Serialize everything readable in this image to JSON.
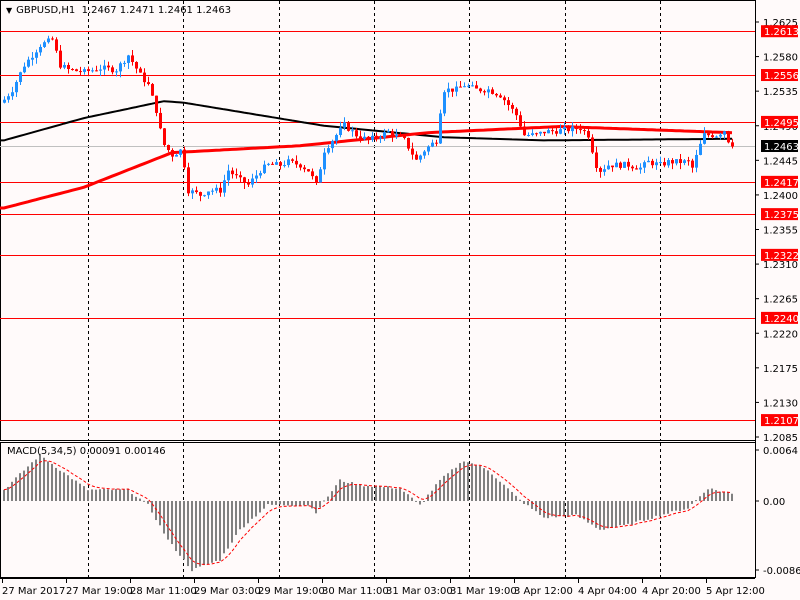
{
  "header": {
    "symbol": "GBPUSD,H1",
    "ohlc": "1.2467 1.2471 1.2461 1.2463",
    "menu_icon": "triangle-down-icon"
  },
  "macd_label": {
    "name": "MACD(5,34,5)",
    "values": "0.00091 0.00146"
  },
  "colors": {
    "bull": "#1e90ff",
    "bear": "#ff0000",
    "level": "#ff0000",
    "ma_slow": "#ff0000",
    "ma_fast": "#000000",
    "macd_hist": "#808080",
    "current": "#000000",
    "background": "#fffafa"
  },
  "chart_data": {
    "type": "candlestick",
    "title": "GBPUSD,H1",
    "ylim": [
      1.2085,
      1.2625
    ],
    "y_ticks": [
      "1.2625",
      "1.2580",
      "1.2535",
      "1.2490",
      "1.2445",
      "1.2400",
      "1.2355",
      "1.2310",
      "1.2265",
      "1.2220",
      "1.2175",
      "1.2130",
      "1.2085"
    ],
    "x_ticks": [
      "27 Mar 2017",
      "27 Mar 19:00",
      "28 Mar 11:00",
      "29 Mar 03:00",
      "29 Mar 19:00",
      "30 Mar 11:00",
      "31 Mar 03:00",
      "31 Mar 19:00",
      "3 Apr 12:00",
      "4 Apr 04:00",
      "4 Apr 20:00",
      "5 Apr 12:00"
    ],
    "levels": [
      "1.2613",
      "1.2556",
      "1.2495",
      "1.2417",
      "1.2375",
      "1.2322",
      "1.2240",
      "1.2107"
    ],
    "current_price": "1.2463",
    "close_keypoints": [
      [
        0,
        1.2524
      ],
      [
        2,
        1.2537
      ],
      [
        5,
        1.2569
      ],
      [
        9,
        1.2595
      ],
      [
        12,
        1.2602
      ],
      [
        14,
        1.2569
      ],
      [
        16,
        1.2563
      ],
      [
        20,
        1.256
      ],
      [
        24,
        1.2565
      ],
      [
        28,
        1.2563
      ],
      [
        31,
        1.2582
      ],
      [
        34,
        1.2556
      ],
      [
        36,
        1.2543
      ],
      [
        38,
        1.251
      ],
      [
        39,
        1.2484
      ],
      [
        40,
        1.2465
      ],
      [
        42,
        1.2452
      ],
      [
        44,
        1.2458
      ],
      [
        45,
        1.2439
      ],
      [
        46,
        1.2406
      ],
      [
        49,
        1.24
      ],
      [
        51,
        1.2406
      ],
      [
        54,
        1.2406
      ],
      [
        56,
        1.2432
      ],
      [
        59,
        1.2419
      ],
      [
        61,
        1.2413
      ],
      [
        64,
        1.2432
      ],
      [
        66,
        1.2439
      ],
      [
        69,
        1.2439
      ],
      [
        71,
        1.2443
      ],
      [
        74,
        1.2439
      ],
      [
        76,
        1.2432
      ],
      [
        78,
        1.2413
      ],
      [
        80,
        1.2458
      ],
      [
        83,
        1.2478
      ],
      [
        85,
        1.2491
      ],
      [
        88,
        1.2478
      ],
      [
        91,
        1.2471
      ],
      [
        96,
        1.2482
      ],
      [
        100,
        1.2471
      ],
      [
        103,
        1.2445
      ],
      [
        105,
        1.2458
      ],
      [
        108,
        1.2471
      ],
      [
        109,
        1.251
      ],
      [
        110,
        1.2537
      ],
      [
        113,
        1.2537
      ],
      [
        115,
        1.2543
      ],
      [
        118,
        1.2537
      ],
      [
        121,
        1.2537
      ],
      [
        124,
        1.253
      ],
      [
        125,
        1.2524
      ],
      [
        128,
        1.2504
      ],
      [
        130,
        1.2478
      ],
      [
        133,
        1.2478
      ],
      [
        135,
        1.2482
      ],
      [
        139,
        1.2484
      ],
      [
        144,
        1.2487
      ],
      [
        146,
        1.2478
      ],
      [
        148,
        1.2439
      ],
      [
        149,
        1.2432
      ],
      [
        151,
        1.2439
      ],
      [
        154,
        1.2439
      ],
      [
        156,
        1.2439
      ],
      [
        159,
        1.2435
      ],
      [
        161,
        1.2443
      ],
      [
        164,
        1.2439
      ],
      [
        166,
        1.2443
      ],
      [
        171,
        1.2443
      ],
      [
        172,
        1.2435
      ],
      [
        174,
        1.2465
      ],
      [
        175,
        1.2478
      ],
      [
        178,
        1.2478
      ],
      [
        180,
        1.2484
      ],
      [
        181,
        1.2471
      ],
      [
        182,
        1.2463
      ]
    ],
    "ma_fast_keypoints": [
      [
        0,
        1.2471
      ],
      [
        20,
        1.25
      ],
      [
        40,
        1.2522
      ],
      [
        45,
        1.252
      ],
      [
        80,
        1.249
      ],
      [
        110,
        1.2475
      ],
      [
        135,
        1.2471
      ],
      [
        182,
        1.2473
      ]
    ],
    "ma_slow_keypoints": [
      [
        0,
        1.2383
      ],
      [
        20,
        1.241
      ],
      [
        42,
        1.2455
      ],
      [
        74,
        1.2464
      ],
      [
        106,
        1.2481
      ],
      [
        139,
        1.2489
      ],
      [
        182,
        1.2481
      ]
    ],
    "macd": {
      "ylim": [
        -0.00867,
        0.0064
      ],
      "y_ticks": [
        "0.0064",
        "0.00",
        "-0.00867"
      ],
      "hist_keypoints": [
        [
          0,
          0.0014
        ],
        [
          9,
          0.0058
        ],
        [
          14,
          0.0039
        ],
        [
          21,
          0.0014
        ],
        [
          31,
          0.0014
        ],
        [
          36,
          -0.0005
        ],
        [
          41,
          -0.0049
        ],
        [
          47,
          -0.0087
        ],
        [
          54,
          -0.0074
        ],
        [
          59,
          -0.0036
        ],
        [
          66,
          -0.0005
        ],
        [
          76,
          -0.0005
        ],
        [
          78,
          -0.0014
        ],
        [
          84,
          0.0026
        ],
        [
          89,
          0.002
        ],
        [
          99,
          0.0016
        ],
        [
          104,
          -0.0005
        ],
        [
          109,
          0.0026
        ],
        [
          115,
          0.0051
        ],
        [
          121,
          0.0039
        ],
        [
          129,
          0.0001
        ],
        [
          135,
          -0.0021
        ],
        [
          143,
          -0.0018
        ],
        [
          149,
          -0.0036
        ],
        [
          156,
          -0.003
        ],
        [
          164,
          -0.0018
        ],
        [
          171,
          -0.0009
        ],
        [
          176,
          0.0016
        ],
        [
          182,
          0.0009
        ]
      ]
    }
  }
}
